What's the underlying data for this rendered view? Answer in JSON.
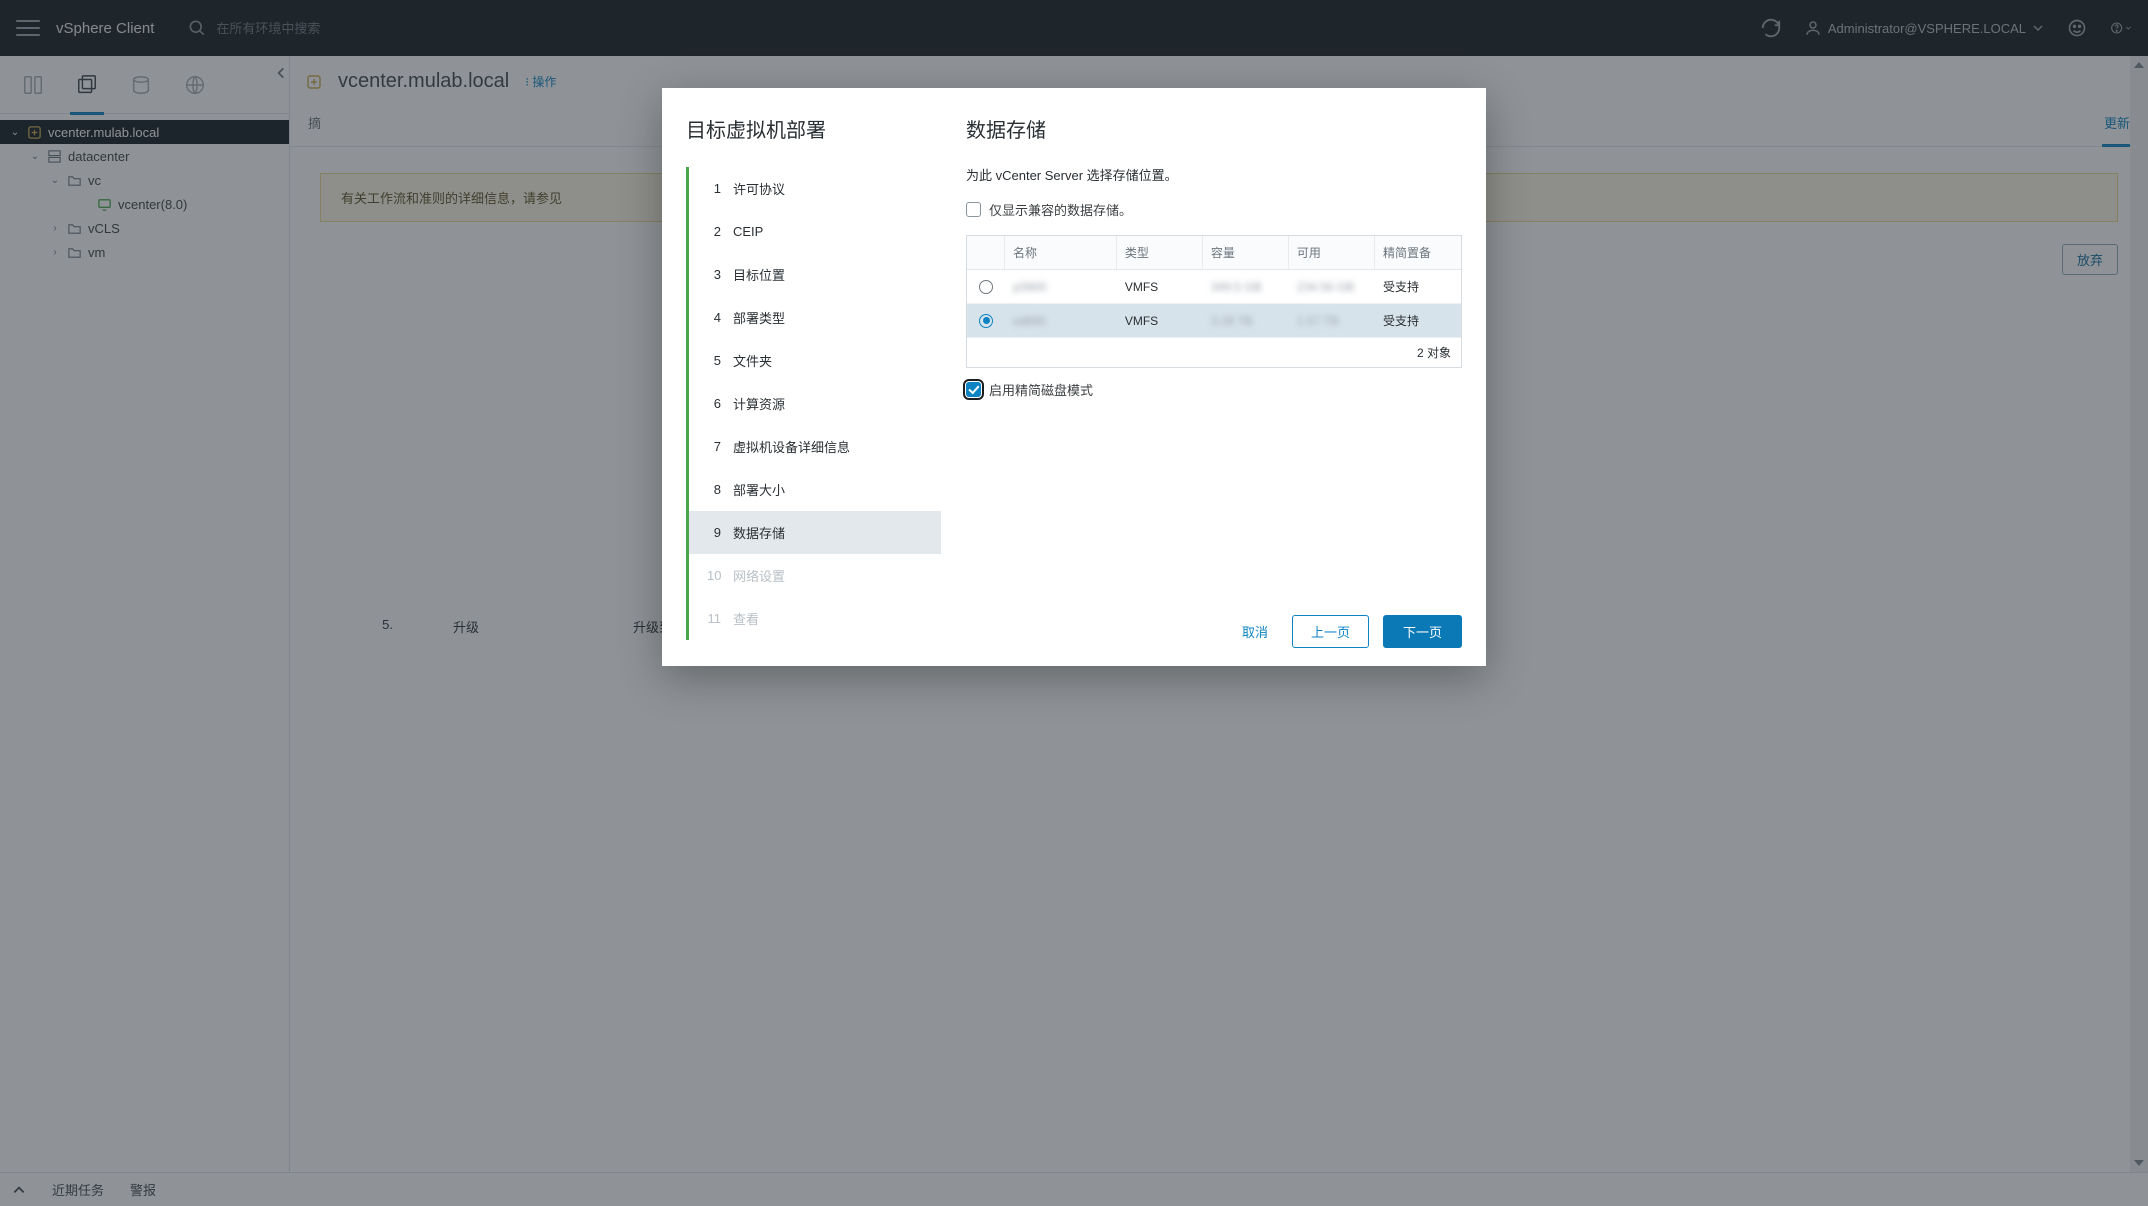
{
  "header": {
    "app_title": "vSphere Client",
    "search_placeholder": "在所有环境中搜索",
    "user": "Administrator@VSPHERE.LOCAL"
  },
  "tree": {
    "vcenter": "vcenter.mulab.local",
    "datacenter": "datacenter",
    "vc": "vc",
    "vcenter_vm": "vcenter(8.0)",
    "vcls": "vCLS",
    "vm": "vm"
  },
  "page": {
    "title": "vcenter.mulab.local",
    "actions": "操作",
    "tabs": {
      "summary": "摘",
      "updates": "更新"
    },
    "alert_text": "有关工作流和准则的详细信息，请参见",
    "discard": "放弃",
    "step5_num": "5.",
    "step5_label": "升级",
    "step5_desc": "升级到新版本。"
  },
  "footer": {
    "recent": "近期任务",
    "alerts": "警报"
  },
  "modal": {
    "wizard_title": "目标虚拟机部署",
    "steps": [
      {
        "n": "1",
        "label": "许可协议"
      },
      {
        "n": "2",
        "label": "CEIP"
      },
      {
        "n": "3",
        "label": "目标位置"
      },
      {
        "n": "4",
        "label": "部署类型"
      },
      {
        "n": "5",
        "label": "文件夹"
      },
      {
        "n": "6",
        "label": "计算资源"
      },
      {
        "n": "7",
        "label": "虚拟机设备详细信息"
      },
      {
        "n": "8",
        "label": "部署大小"
      },
      {
        "n": "9",
        "label": "数据存储"
      },
      {
        "n": "10",
        "label": "网络设置"
      },
      {
        "n": "11",
        "label": "查看"
      }
    ],
    "section_title": "数据存储",
    "hint": "为此 vCenter Server 选择存储位置。",
    "only_compatible": "仅显示兼容的数据存储。",
    "thin_mode": "启用精简磁盘模式",
    "table": {
      "headers": {
        "name": "名称",
        "type": "类型",
        "capacity": "容量",
        "free": "可用",
        "thin": "精简置备"
      },
      "rows": [
        {
          "name": "p3900",
          "type": "VMFS",
          "capacity": "349.5 GB",
          "free": "234.56 GB",
          "thin": "受支持",
          "selected": false
        },
        {
          "name": "sd890",
          "type": "VMFS",
          "capacity": "3.28 TB",
          "free": "1.57 TB",
          "thin": "受支持",
          "selected": true
        }
      ],
      "footer": "2 对象"
    },
    "buttons": {
      "cancel": "取消",
      "prev": "上一页",
      "next": "下一页"
    }
  }
}
